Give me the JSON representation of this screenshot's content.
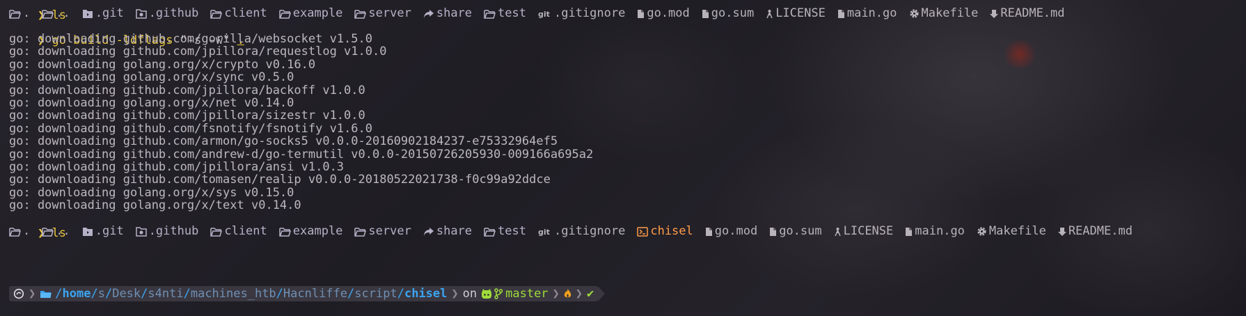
{
  "prompt_symbol": "❯",
  "lines": {
    "top_cmd": "ls",
    "build_cmd": "go build -ldflags",
    "build_arg": "\"-s -w\"",
    "build_dot": ".",
    "second_cmd": "ls"
  },
  "ls_first": [
    {
      "icon": "folder-open-icon",
      "name": ".",
      "kind": "dir"
    },
    {
      "icon": "folder-open-icon",
      "name": "..",
      "kind": "dir"
    },
    {
      "icon": "git-folder-icon",
      "name": ".git",
      "kind": "dir"
    },
    {
      "icon": "github-folder-icon",
      "name": ".github",
      "kind": "dir"
    },
    {
      "icon": "folder-open-icon",
      "name": "client",
      "kind": "dir"
    },
    {
      "icon": "folder-open-icon",
      "name": "example",
      "kind": "dir"
    },
    {
      "icon": "folder-open-icon",
      "name": "server",
      "kind": "dir"
    },
    {
      "icon": "share-icon",
      "name": "share",
      "kind": "dir"
    },
    {
      "icon": "folder-open-icon",
      "name": "test",
      "kind": "dir"
    },
    {
      "icon": "git-icon",
      "name": ".gitignore",
      "kind": "file"
    },
    {
      "icon": "file-icon",
      "name": "go.mod",
      "kind": "file"
    },
    {
      "icon": "file-icon",
      "name": "go.sum",
      "kind": "file"
    },
    {
      "icon": "license-icon",
      "name": "LICENSE",
      "kind": "file"
    },
    {
      "icon": "file-icon",
      "name": "main.go",
      "kind": "file"
    },
    {
      "icon": "gear-icon",
      "name": "Makefile",
      "kind": "file"
    },
    {
      "icon": "download-icon",
      "name": "README.md",
      "kind": "file"
    }
  ],
  "downloads": [
    "go: downloading github.com/gorilla/websocket v1.5.0",
    "go: downloading github.com/jpillora/requestlog v1.0.0",
    "go: downloading golang.org/x/crypto v0.16.0",
    "go: downloading golang.org/x/sync v0.5.0",
    "go: downloading github.com/jpillora/backoff v1.0.0",
    "go: downloading golang.org/x/net v0.14.0",
    "go: downloading github.com/jpillora/sizestr v1.0.0",
    "go: downloading github.com/fsnotify/fsnotify v1.6.0",
    "go: downloading github.com/armon/go-socks5 v0.0.0-20160902184237-e75332964ef5",
    "go: downloading github.com/andrew-d/go-termutil v0.0.0-20150726205930-009166a695a2",
    "go: downloading github.com/jpillora/ansi v1.0.3",
    "go: downloading github.com/tomasen/realip v0.0.0-20180522021738-f0c99a92ddce",
    "go: downloading golang.org/x/sys v0.15.0",
    "go: downloading golang.org/x/text v0.14.0"
  ],
  "ls_second": [
    {
      "icon": "folder-open-icon",
      "name": ".",
      "kind": "dir"
    },
    {
      "icon": "folder-open-icon",
      "name": "..",
      "kind": "dir"
    },
    {
      "icon": "git-folder-icon",
      "name": ".git",
      "kind": "dir"
    },
    {
      "icon": "github-folder-icon",
      "name": ".github",
      "kind": "dir"
    },
    {
      "icon": "folder-open-icon",
      "name": "client",
      "kind": "dir"
    },
    {
      "icon": "folder-open-icon",
      "name": "example",
      "kind": "dir"
    },
    {
      "icon": "folder-open-icon",
      "name": "server",
      "kind": "dir"
    },
    {
      "icon": "share-icon",
      "name": "share",
      "kind": "dir"
    },
    {
      "icon": "folder-open-icon",
      "name": "test",
      "kind": "dir"
    },
    {
      "icon": "git-icon",
      "name": ".gitignore",
      "kind": "file"
    },
    {
      "icon": "terminal-icon",
      "name": "chisel",
      "kind": "exe"
    },
    {
      "icon": "file-icon",
      "name": "go.mod",
      "kind": "file"
    },
    {
      "icon": "file-icon",
      "name": "go.sum",
      "kind": "file"
    },
    {
      "icon": "license-icon",
      "name": "LICENSE",
      "kind": "file"
    },
    {
      "icon": "file-icon",
      "name": "main.go",
      "kind": "file"
    },
    {
      "icon": "gear-icon",
      "name": "Makefile",
      "kind": "file"
    },
    {
      "icon": "download-icon",
      "name": "README.md",
      "kind": "file"
    }
  ],
  "status": {
    "path_parts": [
      "/",
      "home",
      "/",
      "s",
      "/",
      "Desk",
      "/",
      "s4nti",
      "/",
      "machines_htb",
      "/",
      "Hacnliffe",
      "/",
      "script",
      "/",
      "chisel"
    ],
    "on_label": "on",
    "branch": "master",
    "check": "✔"
  },
  "colors": {
    "background": "#211f26",
    "prompt": "#e8c63c",
    "path": "#3ba4f0",
    "git": "#9fdc3a",
    "exe": "#ff9c4a"
  }
}
